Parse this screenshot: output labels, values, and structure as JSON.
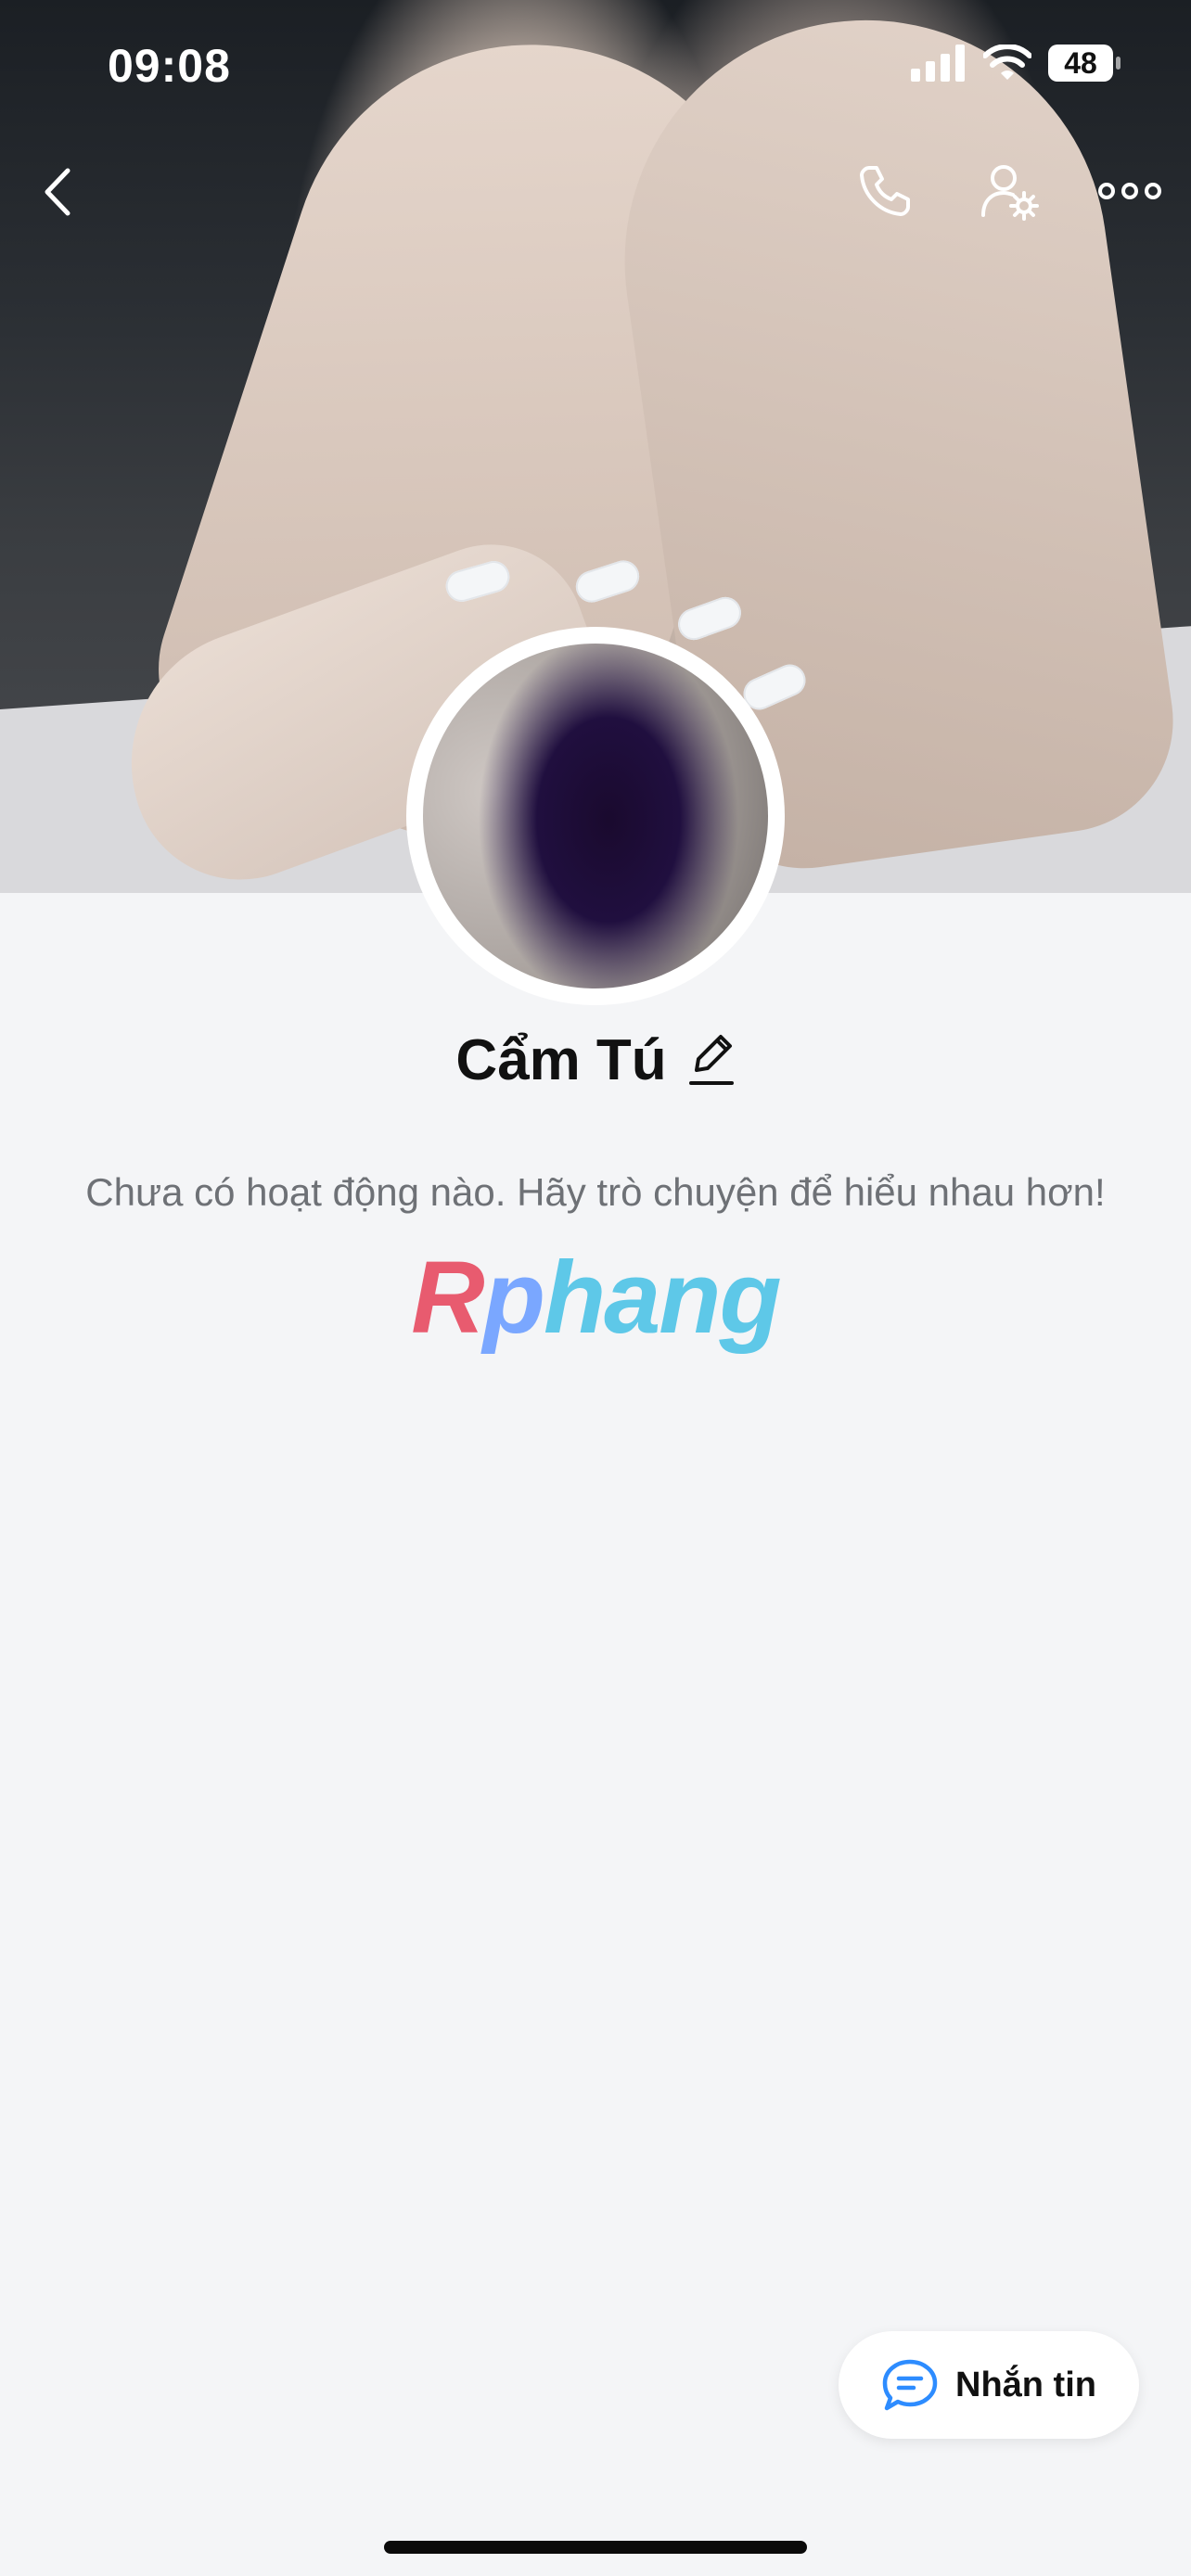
{
  "status_bar": {
    "time": "09:08",
    "battery": "48"
  },
  "nav": {
    "back_icon": "chevron-left-icon",
    "call_icon": "phone-icon",
    "profile_settings_icon": "user-gear-icon",
    "more_icon": "more-icon"
  },
  "profile": {
    "name": "Cẩm Tú",
    "edit_icon": "pencil-icon",
    "activity_text": "Chưa có hoạt động nào. Hãy trò chuyện để hiểu nhau hơn!"
  },
  "watermark": {
    "text": "Rphang"
  },
  "actions": {
    "message_label": "Nhắn tin",
    "message_icon": "chat-bubble-icon"
  },
  "colors": {
    "accent": "#2d8cff",
    "background": "#f4f5f7"
  }
}
